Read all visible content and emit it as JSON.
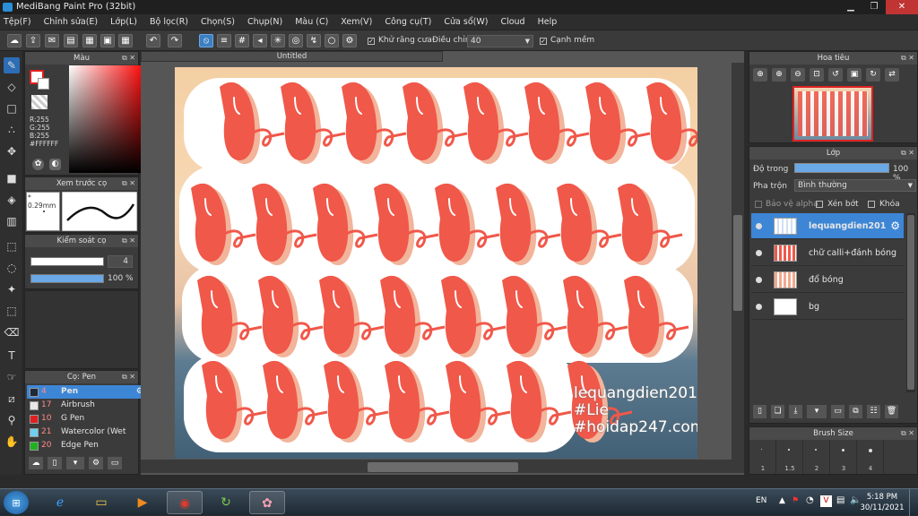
{
  "window": {
    "title": "MediBang Paint Pro (32bit)",
    "buttons": [
      "▁",
      "❐",
      "✕"
    ]
  },
  "menu": [
    "Tệp(F)",
    "Chỉnh sửa(E)",
    "Lớp(L)",
    "Bộ lọc(R)",
    "Chọn(S)",
    "Chụp(N)",
    "Màu (C)",
    "Xem(V)",
    "Công cụ(T)",
    "Cửa sổ(W)",
    "Cloud",
    "Help"
  ],
  "toolbar": {
    "antialias_label": "Khử răng cưa",
    "correction_label": "Điều chỉnh",
    "correction_value": "40",
    "sharp_edge_label": "Cạnh mềm"
  },
  "color_panel": {
    "title": "Màu",
    "r": "R:255",
    "g": "G:255",
    "b": "B:255",
    "hex": "#FFFFFF",
    "primary_color": "#e02020",
    "secondary_color": "#ffffff"
  },
  "brush_preview": {
    "title": "Xem trước cọ",
    "size": "0.29mm"
  },
  "brush_control": {
    "title": "Kiểm soát cọ",
    "size_value": "4",
    "opacity_value": "100 %"
  },
  "brush_list": {
    "title": "Cọ: Pen",
    "items": [
      {
        "size": "4",
        "name": "Pen",
        "color": "#1e2a3a"
      },
      {
        "size": "17",
        "name": "Airbrush",
        "color": "#e8e8e8"
      },
      {
        "size": "10",
        "name": "G Pen",
        "color": "#e02020"
      },
      {
        "size": "21",
        "name": "Watercolor (Wet",
        "color": "#6fd0f0"
      },
      {
        "size": "20",
        "name": "Edge Pen",
        "color": "#20b020"
      }
    ]
  },
  "document": {
    "tab": "Untitled",
    "watermark": [
      "lequangdien201",
      "#Lie",
      "#hoidap247.com"
    ]
  },
  "navigator": {
    "title": "Hoa tiêu"
  },
  "layer_panel": {
    "title": "Lớp",
    "opacity_label": "Độ trong",
    "opacity_value": "100 %",
    "blend_label": "Pha trộn",
    "blend_value": "Bình thường",
    "protect_alpha": "Bảo vệ alpha",
    "clipping": "Xén bớt",
    "lock": "Khóa",
    "layers": [
      {
        "name": "lequangdien201"
      },
      {
        "name": "chữ calli+đánh bóng"
      },
      {
        "name": "đổ bóng"
      },
      {
        "name": "bg"
      }
    ]
  },
  "brush_size": {
    "title": "Brush Size",
    "sizes": [
      "1",
      "1.5",
      "2",
      "3",
      "4"
    ]
  },
  "taskbar": {
    "lang": "EN",
    "time": "5:18 PM",
    "date": "30/11/2021"
  }
}
